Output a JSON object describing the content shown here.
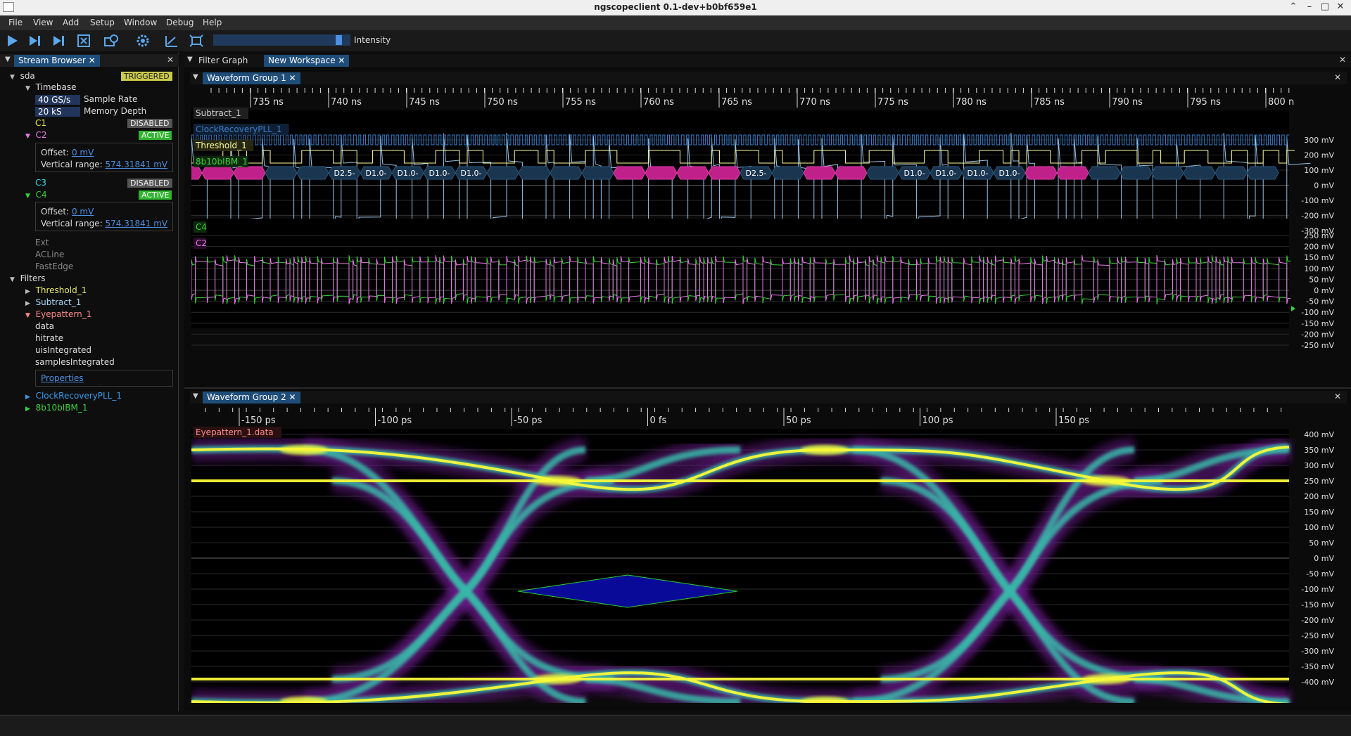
{
  "window": {
    "title": "ngscopeclient 0.1-dev+b0bf659e1"
  },
  "menu": [
    "File",
    "View",
    "Add",
    "Setup",
    "Window",
    "Debug",
    "Help"
  ],
  "toolbar": {
    "icons": [
      "run-icon",
      "single-icon",
      "force-icon",
      "stop-icon",
      "history-icon",
      "settings-icon",
      "measure-icon",
      "fit-icon"
    ],
    "intensity_label": "Intensity",
    "intensity_level": 0.95
  },
  "stream_browser": {
    "tab": "Stream Browser",
    "device": "sda",
    "device_status": "TRIGGERED",
    "timebase_label": "Timebase",
    "sample_rate_value": "40 GS/s",
    "sample_rate_label": "Sample Rate",
    "memory_depth_value": "20 kS",
    "memory_depth_label": "Memory Depth",
    "channels": {
      "c1": {
        "name": "C1",
        "status": "DISABLED"
      },
      "c2": {
        "name": "C2",
        "status": "ACTIVE",
        "offset_label": "Offset:",
        "offset": "0 mV",
        "vrange_label": "Vertical range:",
        "vrange": "574.31841 mV"
      },
      "c3": {
        "name": "C3",
        "status": "DISABLED"
      },
      "c4": {
        "name": "C4",
        "status": "ACTIVE",
        "offset_label": "Offset:",
        "offset": "0 mV",
        "vrange_label": "Vertical range:",
        "vrange": "574.31841 mV"
      }
    },
    "ext": [
      "Ext",
      "ACLine",
      "FastEdge"
    ],
    "filters_label": "Filters",
    "filters": {
      "threshold": "Threshold_1",
      "subtract": "Subtract_1",
      "eyepattern": "Eyepattern_1",
      "eye_streams": [
        "data",
        "hitrate",
        "uisIntegrated",
        "samplesIntegrated"
      ],
      "properties": "Properties",
      "clock": "ClockRecoveryPLL_1",
      "decoder": "8b10bIBM_1"
    }
  },
  "workspace": {
    "tabs": [
      "Filter Graph",
      "New Workspace"
    ],
    "group1": {
      "tab": "Waveform Group 1",
      "time_ticks": [
        "735 ns",
        "740 ns",
        "745 ns",
        "750 ns",
        "755 ns",
        "760 ns",
        "765 ns",
        "770 ns",
        "775 ns",
        "780 ns",
        "785 ns",
        "790 ns",
        "795 ns",
        "800 n"
      ],
      "area1_traces": [
        "Subtract_1",
        "ClockRecoveryPLL_1",
        "Threshold_1",
        "8b10bIBM_1"
      ],
      "area1_volts": [
        "300 mV",
        "200 mV",
        "100 mV",
        "0 mV",
        "-100 mV",
        "-200 mV",
        "-300 mV"
      ],
      "decode_symbols": [
        "D2.5-",
        "D1.0-",
        "D1.0-",
        "D1.0-",
        "D1.0-",
        "D2.5-",
        "D1.0-",
        "D1.0-",
        "D1.0-",
        "D1.0-"
      ],
      "area2_traces": [
        "C4",
        "C2"
      ],
      "area2_volts": [
        "250 mV",
        "200 mV",
        "150 mV",
        "100 mV",
        "50 mV",
        "0 mV",
        "-50 mV",
        "-100 mV",
        "-150 mV",
        "-200 mV",
        "-250 mV"
      ]
    },
    "group2": {
      "tab": "Waveform Group 2",
      "time_ticks": [
        "-150 ps",
        "-100 ps",
        "-50 ps",
        "0 fs",
        "50 ps",
        "100 ps",
        "150 ps"
      ],
      "trace": "Eyepattern_1.data",
      "volts": [
        "400 mV",
        "350 mV",
        "300 mV",
        "250 mV",
        "200 mV",
        "150 mV",
        "100 mV",
        "50 mV",
        "0 mV",
        "-50 mV",
        "-100 mV",
        "-150 mV",
        "-200 mV",
        "-250 mV",
        "-300 mV",
        "-350 mV",
        "-400 mV"
      ]
    }
  },
  "colors": {
    "subtract": "#a8d8ff",
    "clock": "#3a7dc8",
    "threshold": "#ffffa0",
    "decoder_data": "#1a3550",
    "decoder_ctrl": "#c0208a",
    "c4": "#3ad13a",
    "c2": "#e878e8",
    "eye_hot": "#f8f838",
    "eye_mid": "#38b8a8",
    "eye_low": "#6a1a8a"
  }
}
